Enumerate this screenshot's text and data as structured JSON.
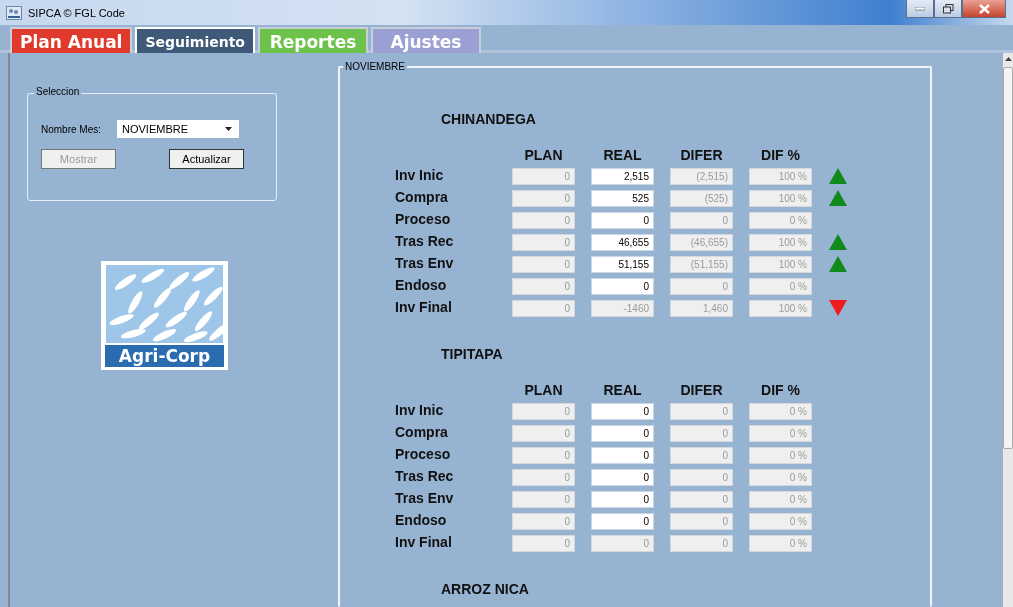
{
  "window": {
    "title": "SIPCA © FGL Code"
  },
  "tabs": [
    {
      "label": "Plan Anual",
      "selected": false,
      "color": "#e03a2c"
    },
    {
      "label": "Seguimiento",
      "selected": true,
      "color": "#3f5a78"
    },
    {
      "label": "Reportes",
      "selected": false,
      "color": "#6cc24a"
    },
    {
      "label": "Ajustes",
      "selected": false,
      "color": "#9aa0d4"
    }
  ],
  "selection": {
    "title": "Seleccion",
    "month_label": "Nombre Mes:",
    "month_value": "NOVIEMBRE",
    "buttons": [
      {
        "label": "Mostrar",
        "disabled": true
      },
      {
        "label": "Actualizar",
        "disabled": false
      }
    ]
  },
  "logo": {
    "text": "Agri-Corp"
  },
  "month_group": {
    "title": "NOVIEMBRE"
  },
  "sections": [
    {
      "name": "CHINANDEGA",
      "columns": [
        "PLAN",
        "REAL",
        "DIFER",
        "DIF %"
      ],
      "rows": [
        {
          "label": "Inv Inic",
          "plan": "0",
          "real": "2,515",
          "real_disabled": false,
          "difer": "(2,515)",
          "dif_pct": "100 %",
          "arrow": {
            "kind": "up",
            "color": "#118a1c"
          }
        },
        {
          "label": "Compra",
          "plan": "0",
          "real": "525",
          "real_disabled": false,
          "difer": "(525)",
          "dif_pct": "100 %",
          "arrow": {
            "kind": "up",
            "color": "#118a1c"
          }
        },
        {
          "label": "Proceso",
          "plan": "0",
          "real": "0",
          "real_disabled": false,
          "difer": "0",
          "dif_pct": "0 %"
        },
        {
          "label": "Tras Rec",
          "plan": "0",
          "real": "46,655",
          "real_disabled": false,
          "difer": "(46,655)",
          "dif_pct": "100 %",
          "arrow": {
            "kind": "up",
            "color": "#118a1c"
          }
        },
        {
          "label": "Tras Env",
          "plan": "0",
          "real": "51,155",
          "real_disabled": false,
          "difer": "(51,155)",
          "dif_pct": "100 %",
          "arrow": {
            "kind": "up",
            "color": "#118a1c"
          }
        },
        {
          "label": "Endoso",
          "plan": "0",
          "real": "0",
          "real_disabled": false,
          "difer": "0",
          "dif_pct": "0 %"
        },
        {
          "label": "Inv Final",
          "plan": "0",
          "real": "-1460",
          "real_disabled": true,
          "difer": "1,460",
          "dif_pct": "100 %",
          "arrow": {
            "kind": "down",
            "color": "#ee1c1c"
          }
        }
      ]
    },
    {
      "name": "TIPITAPA",
      "columns": [
        "PLAN",
        "REAL",
        "DIFER",
        "DIF %"
      ],
      "rows": [
        {
          "label": "Inv Inic",
          "plan": "0",
          "real": "0",
          "real_disabled": false,
          "difer": "0",
          "dif_pct": "0 %"
        },
        {
          "label": "Compra",
          "plan": "0",
          "real": "0",
          "real_disabled": false,
          "difer": "0",
          "dif_pct": "0 %"
        },
        {
          "label": "Proceso",
          "plan": "0",
          "real": "0",
          "real_disabled": false,
          "difer": "0",
          "dif_pct": "0 %"
        },
        {
          "label": "Tras Rec",
          "plan": "0",
          "real": "0",
          "real_disabled": false,
          "difer": "0",
          "dif_pct": "0 %"
        },
        {
          "label": "Tras Env",
          "plan": "0",
          "real": "0",
          "real_disabled": false,
          "difer": "0",
          "dif_pct": "0 %"
        },
        {
          "label": "Endoso",
          "plan": "0",
          "real": "0",
          "real_disabled": false,
          "difer": "0",
          "dif_pct": "0 %"
        },
        {
          "label": "Inv Final",
          "plan": "0",
          "real": "0",
          "real_disabled": true,
          "difer": "0",
          "dif_pct": "0 %"
        }
      ]
    },
    {
      "name": "ARROZ NICA"
    }
  ]
}
